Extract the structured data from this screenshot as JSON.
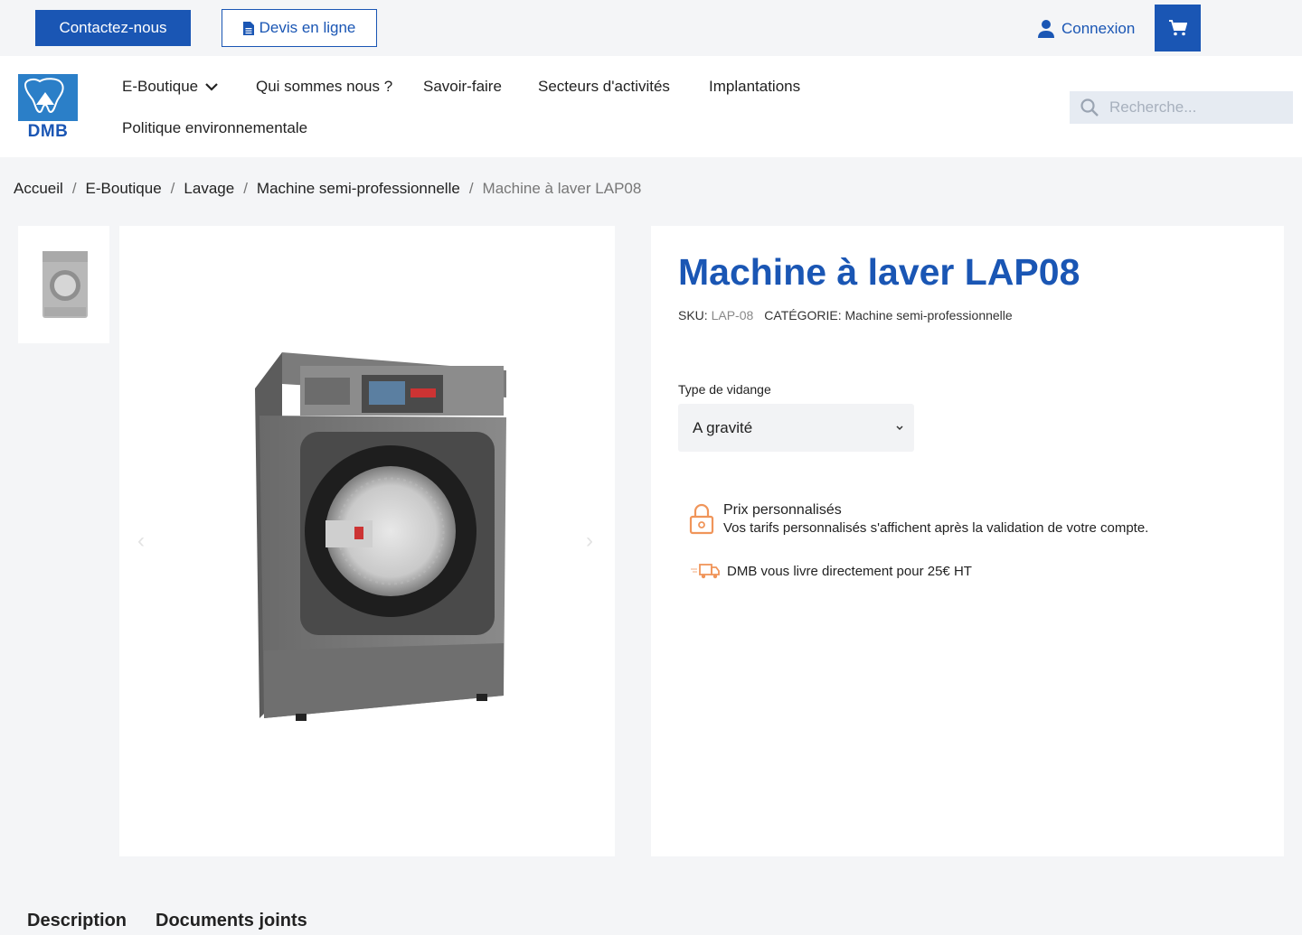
{
  "topbar": {
    "contact_label": "Contactez-nous",
    "devis_label": "Devis en ligne",
    "login_label": "Connexion"
  },
  "logo": {
    "text": "DMB"
  },
  "nav": {
    "items": [
      "E-Boutique",
      "Qui sommes nous ?",
      "Savoir-faire",
      "Secteurs d'activités",
      "Implantations",
      "Politique environnementale"
    ]
  },
  "search": {
    "placeholder": "Recherche..."
  },
  "breadcrumb": [
    "Accueil",
    "E-Boutique",
    "Lavage",
    "Machine semi-professionnelle",
    "Machine à laver LAP08"
  ],
  "breadcrumb_sep": "/",
  "product": {
    "title": "Machine à laver LAP08",
    "sku_label": "SKU:",
    "sku_value": "LAP-08",
    "category_label": "CATÉGORIE:",
    "category_value": "Machine semi-professionnelle",
    "option_label": "Type de vidange",
    "option_selected": "A gravité",
    "price_title": "Prix personnalisés",
    "price_sub": "Vos tarifs personnalisés s'affichent après la validation de votre compte.",
    "delivery_text": "DMB vous livre directement pour 25€ HT"
  },
  "tabs": [
    "Description",
    "Documents joints"
  ],
  "colors": {
    "brand": "#1a56b4",
    "accent_orange": "#f0955a"
  }
}
